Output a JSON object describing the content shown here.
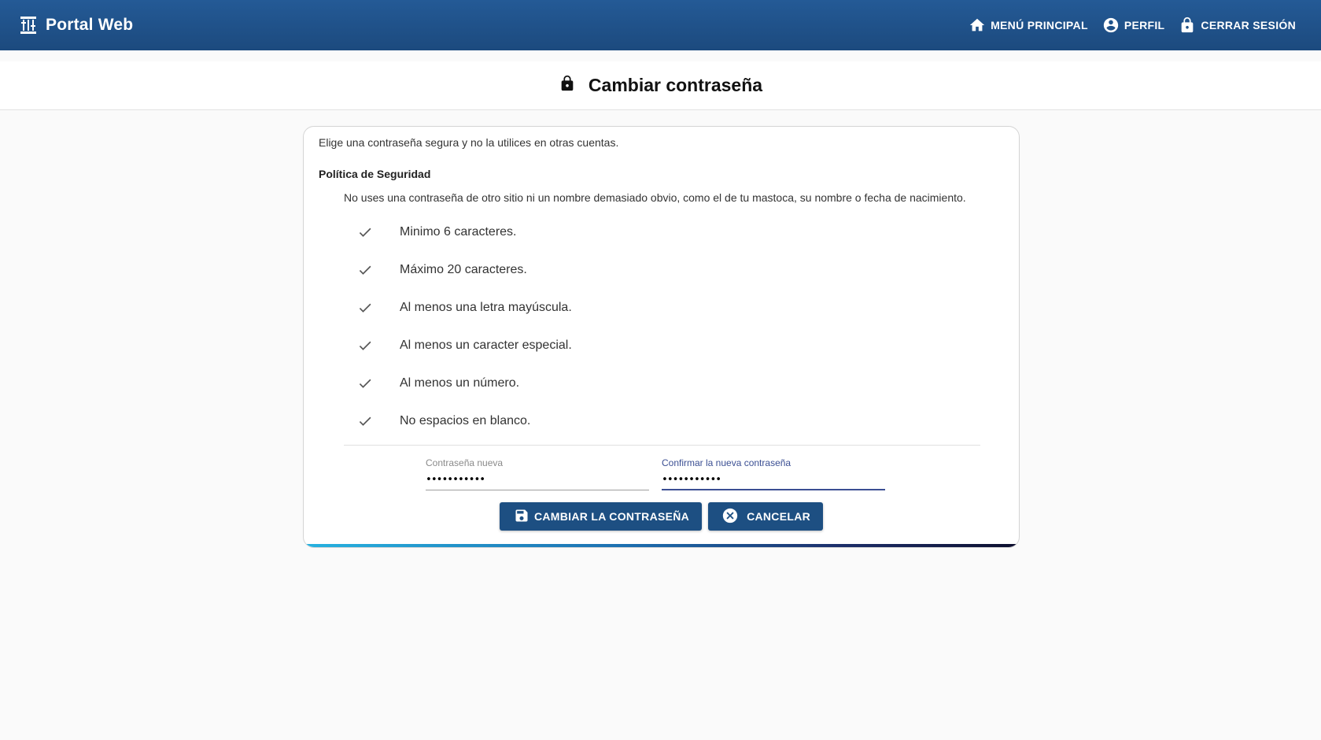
{
  "app": {
    "title": "Portal Web",
    "brand_color": "#1f5189",
    "logo_icon": "building-columns-icon"
  },
  "nav": {
    "items": [
      {
        "label": "MENÚ PRINCIPAL",
        "icon": "home-icon"
      },
      {
        "label": "PERFIL",
        "icon": "account-circle-icon"
      },
      {
        "label": "CERRAR SESIÓN",
        "icon": "lock-icon"
      }
    ]
  },
  "page": {
    "title": "Cambiar contraseña",
    "title_icon": "lock-icon"
  },
  "form": {
    "intro": "Elige una contraseña segura y no la utilices en otras cuentas.",
    "policy_title": "Política de Seguridad",
    "policy_description": "No uses una contraseña de otro sitio ni un nombre demasiado obvio, como el de tu mastoca, su nombre o fecha de nacimiento.",
    "rules": [
      {
        "text": "Minimo 6 caracteres."
      },
      {
        "text": "Máximo 20 caracteres."
      },
      {
        "text": "Al menos una letra mayúscula."
      },
      {
        "text": "Al menos un caracter especial."
      },
      {
        "text": "Al menos un número."
      },
      {
        "text": "No espacios en blanco."
      }
    ],
    "fields": {
      "new_password": {
        "label": "Contraseña nueva",
        "value": "•••••••••••"
      },
      "confirm_password": {
        "label": "Confirmar la nueva contraseña",
        "value": "•••••••••••"
      }
    },
    "buttons": {
      "save_label": "CAMBIAR LA CONTRASEÑA",
      "cancel_label": "CANCELAR"
    }
  },
  "colors": {
    "topbar": "#1f5189",
    "button": "#1d4f82",
    "focus": "#3b4f93",
    "accent_start": "#27b2e0",
    "accent_end": "#0d0f2e"
  }
}
